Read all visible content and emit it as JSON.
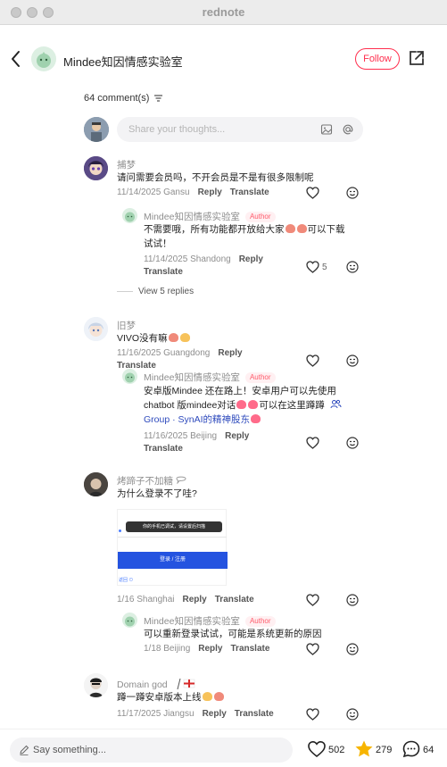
{
  "window": {
    "title": "rednote"
  },
  "header": {
    "author_name": "Mindee知因情感实验室",
    "follow_label": "Follow"
  },
  "comments_section": {
    "count_label": "64 comment(s)",
    "input_placeholder": "Share your thoughts..."
  },
  "comments": [
    {
      "user": "捕梦",
      "text": "请问需要会员吗，不开会员是不是有很多限制呢",
      "meta": "11/14/2025 Gansu",
      "reply_label": "Reply",
      "translate_label": "Translate",
      "reply": {
        "user": "Mindee知因情感实验室",
        "badge": "Author",
        "text_line1": "不需要哦，所有功能都开放给大家",
        "text_line1_tail": "可以下载",
        "text_line2": "试试！",
        "meta": "11/14/2025 Shandong",
        "reply_label": "Reply",
        "translate_label": "Translate",
        "likes": "5"
      },
      "view_more": "View 5 replies"
    },
    {
      "user": "旧梦",
      "text": "VIVO没有嘛",
      "meta": "11/16/2025 Guangdong",
      "reply_label": "Reply",
      "translate_label": "Translate",
      "reply": {
        "user": "Mindee知因情感实验室",
        "badge": "Author",
        "text_line1": "安卓版Mindee 还在路上！安卓用户可以先使用",
        "text_line2_a": "chatbot 版mindee对话",
        "text_line2_b": "可以在这里蹲蹲",
        "text_line3_link": "Group · SynAI的精神股东",
        "meta": "11/16/2025 Beijing",
        "reply_label": "Reply",
        "translate_label": "Translate"
      }
    },
    {
      "user": "烤蹄子不加糖",
      "text": "为什么登录不了哇?",
      "image": {
        "toast": "你的手机已调试，请设置后扫描",
        "button": "登录 / 注册",
        "foot": "返回  ⊙"
      },
      "meta": "1/16 Shanghai",
      "reply_label": "Reply",
      "translate_label": "Translate",
      "reply": {
        "user": "Mindee知因情感实验室",
        "badge": "Author",
        "text": "可以重新登录试试，可能是系统更新的原因",
        "meta": "1/18 Beijing",
        "reply_label": "Reply",
        "translate_label": "Translate"
      }
    },
    {
      "user": "Domain god",
      "text": "蹲一蹲安卓版本上线",
      "meta": "11/17/2025 Jiangsu",
      "reply_label": "Reply",
      "translate_label": "Translate"
    }
  ],
  "bottom_bar": {
    "say_placeholder": "Say something...",
    "likes": "502",
    "stars": "279",
    "comments": "64"
  },
  "colors": {
    "accent": "#ff2e4d",
    "star": "#f7b500",
    "link": "#2f4bbd"
  }
}
